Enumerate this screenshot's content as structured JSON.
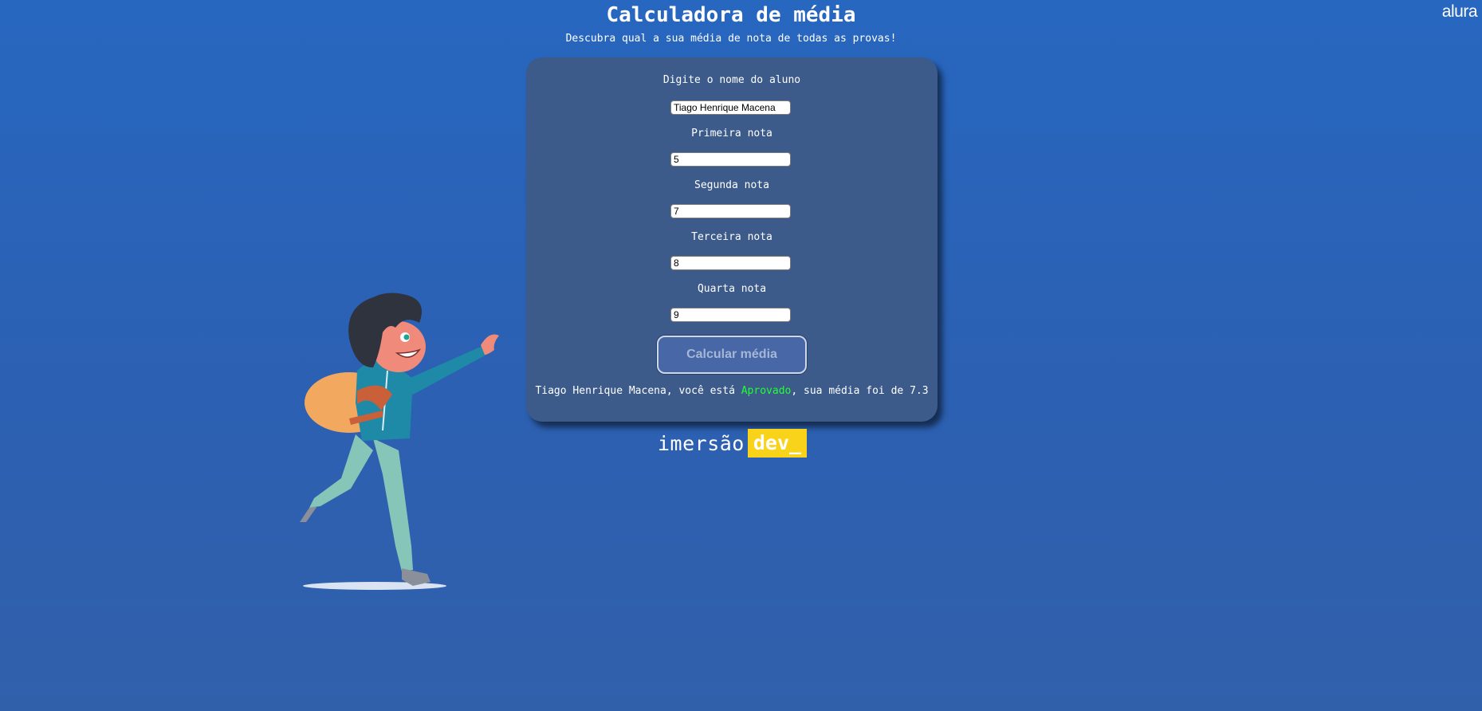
{
  "brand": {
    "logo": "alura"
  },
  "header": {
    "title": "Calculadora de média",
    "subtitle": "Descubra qual a sua média de nota de todas as provas!"
  },
  "form": {
    "name_label": "Digite o nome do aluno",
    "name_value": "Tiago Henrique Macena",
    "grade1_label": "Primeira nota",
    "grade1_value": "5",
    "grade2_label": "Segunda nota",
    "grade2_value": "7",
    "grade3_label": "Terceira nota",
    "grade3_value": "8",
    "grade4_label": "Quarta nota",
    "grade4_value": "9",
    "submit_label": "Calcular média"
  },
  "result": {
    "prefix": "Tiago Henrique Macena, você está ",
    "status": "Aprovado",
    "suffix": ", sua média foi de 7.3",
    "status_color": "#22ff33"
  },
  "footer": {
    "brand_word": "imersão",
    "brand_badge": "dev_",
    "badge_color": "#f8d319"
  },
  "theme": {
    "background": "#2a63b8",
    "card_background": "#3c5b8b",
    "button_background": "#4867a6"
  }
}
